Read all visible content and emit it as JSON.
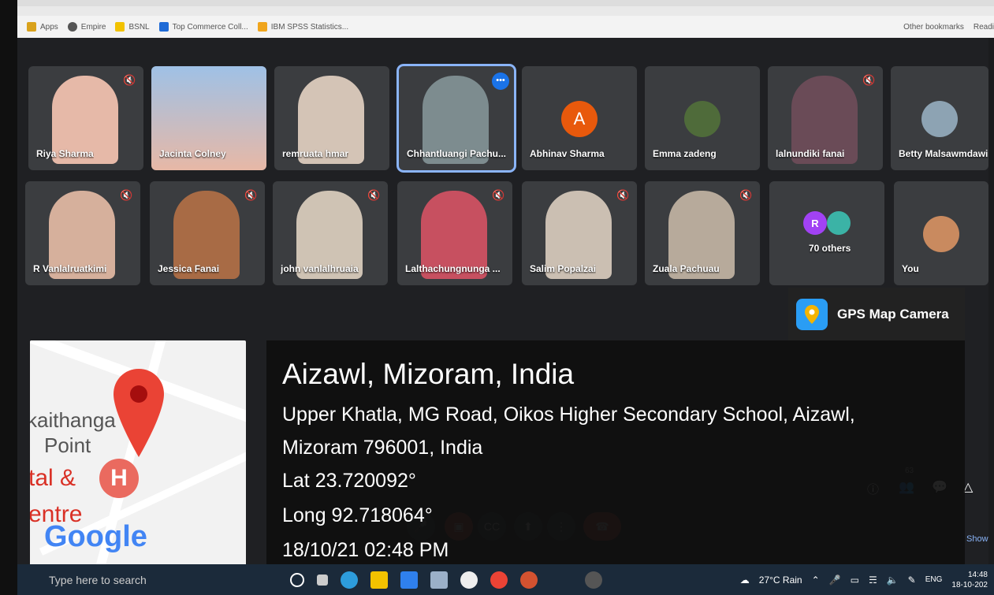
{
  "bookmarks": [
    {
      "label": "Apps",
      "color": "#d9a21c"
    },
    {
      "label": "Empire",
      "color": "#555555"
    },
    {
      "label": "BSNL",
      "color": "#f2c200"
    },
    {
      "label": "Top Commerce Coll...",
      "color": "#1e6ad6"
    },
    {
      "label": "IBM SPSS Statistics...",
      "color": "#f0a51c"
    }
  ],
  "bookmarks_right": {
    "other": "Other bookmarks",
    "reading": "Readi"
  },
  "participants_row1": [
    {
      "name": "Riya Sharma",
      "muted": true
    },
    {
      "name": "Jacinta Colney",
      "muted": false
    },
    {
      "name": "remruata hmar",
      "muted": false
    },
    {
      "name": "Chhantluangi Pachu...",
      "muted": false,
      "active": true
    },
    {
      "name": "Abhinav Sharma",
      "avatar_letter": "A",
      "avatar_color": "#e8590c"
    },
    {
      "name": "Emma zadeng"
    },
    {
      "name": "lalnundiki fanai",
      "muted": true
    },
    {
      "name": "Betty Malsawmdawi"
    }
  ],
  "participants_row2": [
    {
      "name": "R Vanlalruatkimi",
      "muted": true
    },
    {
      "name": "Jessica Fanai",
      "muted": true
    },
    {
      "name": "john vanlalhruaia",
      "muted": true
    },
    {
      "name": "Lalthachungnunga ...",
      "muted": true
    },
    {
      "name": "Salim Popalzai",
      "muted": true
    },
    {
      "name": "Zuala Pachuau",
      "muted": true
    },
    {
      "name": "70 others",
      "badge_letter": "R"
    },
    {
      "name": "You"
    }
  ],
  "gps": {
    "app_name": "GPS Map Camera",
    "city": "Aizawl, Mizoram, India",
    "address_line1": "Upper Khatla, MG Road, Oikos Higher Secondary School, Aizawl,",
    "address_line2": "Mizoram 796001, India",
    "lat": "Lat 23.720092°",
    "long": "Long 92.718064°",
    "datetime": "18/10/21 02:48 PM"
  },
  "map": {
    "label1": "kaithanga",
    "label2": "Point",
    "label3": "tal &",
    "label4": "entre",
    "brand": "Google",
    "hospital": "H"
  },
  "side_badge": "63",
  "show_label": "Show",
  "taskbar": {
    "search_placeholder": "Type here to search",
    "weather": "27°C Rain",
    "lang": "ENG",
    "time": "14:48",
    "date": "18-10-202"
  }
}
